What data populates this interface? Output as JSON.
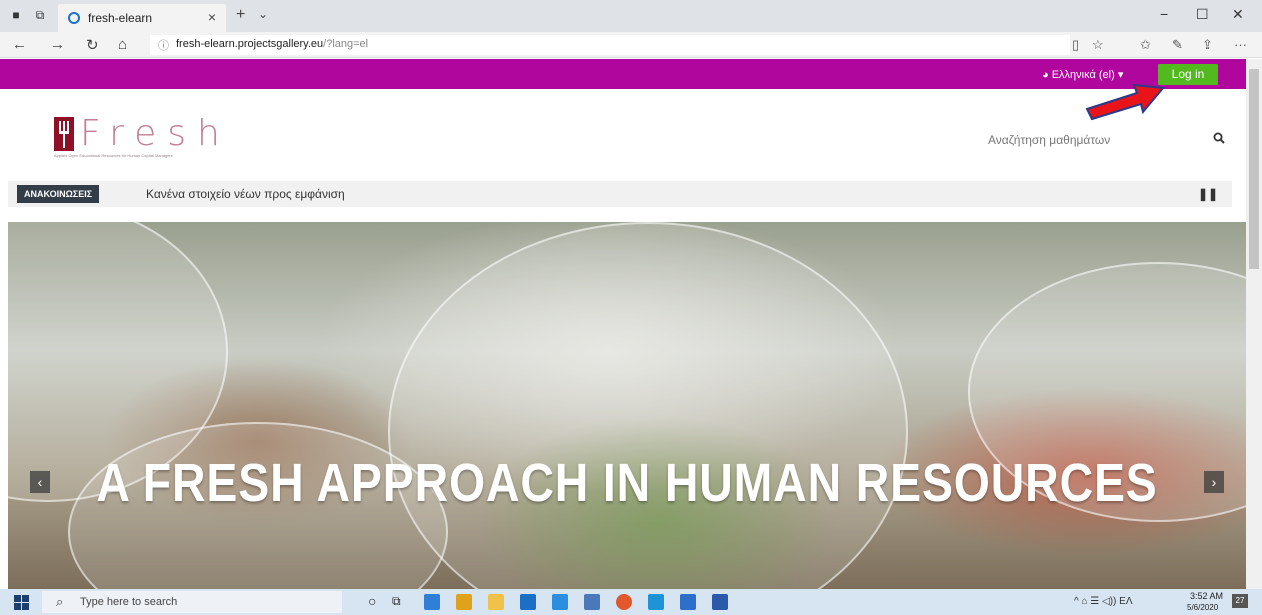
{
  "browser": {
    "tab_title": "fresh-elearn",
    "tab_close": "×",
    "new_tab": "+",
    "tab_dropdown": "⌄",
    "url_host": "fresh-elearn.projectsgallery.eu",
    "url_rest": "/?lang=el",
    "window_controls": [
      "−",
      "☐",
      "✕"
    ],
    "icons": [
      "tab-overview-icon",
      "back-icon",
      "forward-icon",
      "refresh-icon",
      "home-icon",
      "info-icon",
      "reading-view-icon",
      "favorite-star-icon",
      "favorites-icon",
      "pen-icon",
      "share-icon",
      "more-icon"
    ]
  },
  "site": {
    "language": "Ελληνικά (el) ▾",
    "login_label": "Log in",
    "logo_text": "Fresh",
    "logo_tagline": "Applied Open Educational Resources for Human Capital Managers",
    "search_placeholder": "Αναζήτηση μαθημάτων",
    "announcement_label": "ΑΝΑΚΟΙΝΩΣΕΙΣ",
    "announcement_text": "Κανένα στοιχείο νέων προς εμφάνιση",
    "hero_title": "A FRESH APPROACH IN HUMAN RESOURCES",
    "prev_arrow": "‹",
    "next_arrow": "›",
    "accent_color": "#b0069e",
    "login_color": "#52b91f"
  },
  "taskbar": {
    "search_placeholder": "Type here to search",
    "tray": "^ ⌂ ☰ ◁)) ΕΛ",
    "time": "3:52 AM",
    "date": "5/6/2020",
    "notification_count": "27"
  }
}
